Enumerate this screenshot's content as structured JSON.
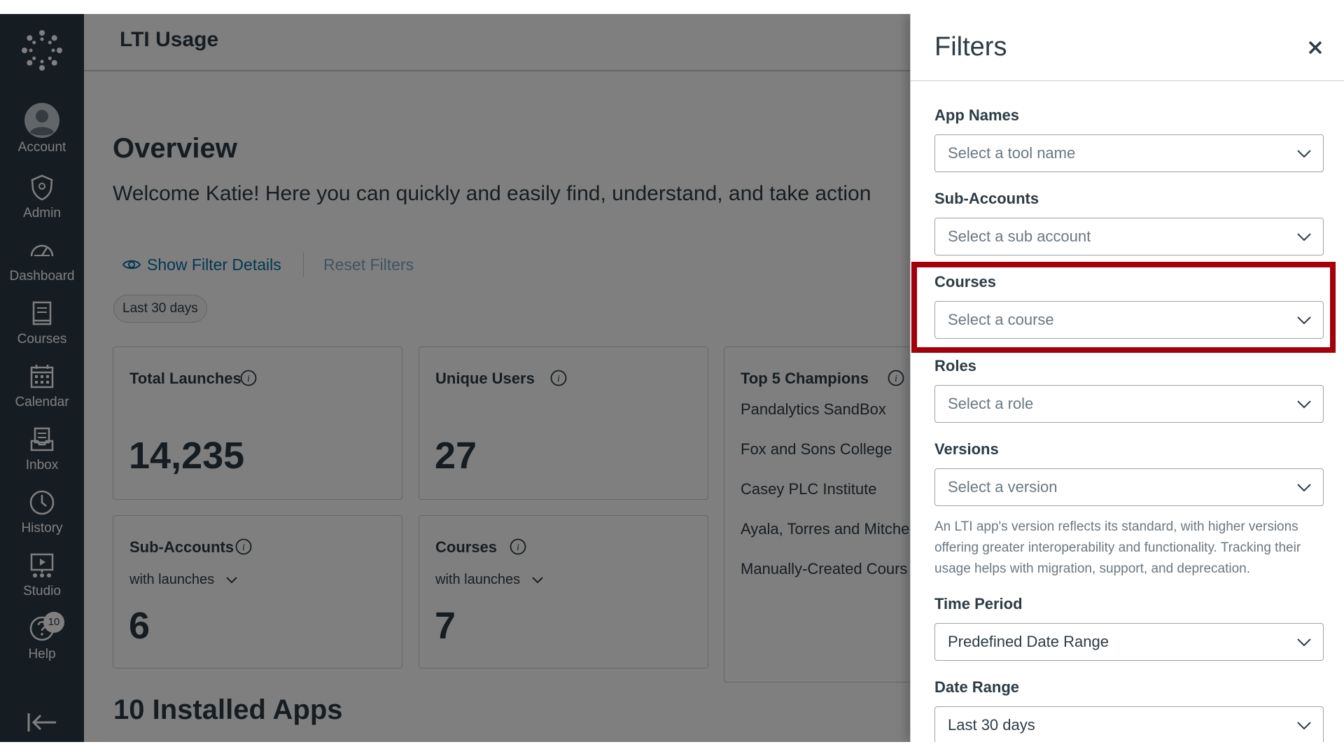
{
  "nav": {
    "items": [
      {
        "label": "Account",
        "icon": "account-icon"
      },
      {
        "label": "Admin",
        "icon": "admin-shield-icon"
      },
      {
        "label": "Dashboard",
        "icon": "dashboard-gauge-icon"
      },
      {
        "label": "Courses",
        "icon": "courses-book-icon"
      },
      {
        "label": "Calendar",
        "icon": "calendar-icon"
      },
      {
        "label": "Inbox",
        "icon": "inbox-icon"
      },
      {
        "label": "History",
        "icon": "history-clock-icon"
      },
      {
        "label": "Studio",
        "icon": "studio-icon"
      },
      {
        "label": "Help",
        "icon": "help-icon",
        "badge": "10"
      }
    ]
  },
  "header": {
    "title": "LTI Usage"
  },
  "overview": {
    "heading": "Overview",
    "welcome": "Welcome Katie! Here you can quickly and easily find, understand, and take action",
    "show_filter_details": "Show Filter Details",
    "reset_filters": "Reset Filters",
    "active_filter_pill": "Last 30 days"
  },
  "cards": {
    "total_launches": {
      "title": "Total Launches",
      "value": "14,235"
    },
    "unique_users": {
      "title": "Unique Users",
      "value": "27"
    },
    "sub_accounts": {
      "title": "Sub-Accounts",
      "subtitle": "with launches",
      "value": "6"
    },
    "courses": {
      "title": "Courses",
      "subtitle": "with launches",
      "value": "7"
    },
    "champions": {
      "title": "Top 5 Champions",
      "items": [
        "Pandalytics SandBox",
        "Fox and Sons College",
        "Casey PLC Institute",
        "Ayala, Torres and Mitche",
        "Manually-Created Cours"
      ]
    }
  },
  "installed_apps_heading": "10 Installed Apps",
  "filters": {
    "title": "Filters",
    "app_names": {
      "label": "App Names",
      "placeholder": "Select a tool name"
    },
    "sub_accounts": {
      "label": "Sub-Accounts",
      "placeholder": "Select a sub account"
    },
    "courses": {
      "label": "Courses",
      "placeholder": "Select a course"
    },
    "roles": {
      "label": "Roles",
      "placeholder": "Select a role"
    },
    "versions": {
      "label": "Versions",
      "placeholder": "Select a version",
      "hint": "An LTI app's version reflects its standard, with higher versions offering greater interoperability and functionality. Tracking their usage helps with migration, support, and deprecation."
    },
    "time_period": {
      "label": "Time Period",
      "value": "Predefined Date Range"
    },
    "date_range": {
      "label": "Date Range",
      "value": "Last 30 days"
    }
  },
  "colors": {
    "nav_bg": "#2d3b45",
    "link": "#0770a3",
    "highlight": "#a3000b",
    "overlay": "rgba(0,0,0,0.5)"
  }
}
